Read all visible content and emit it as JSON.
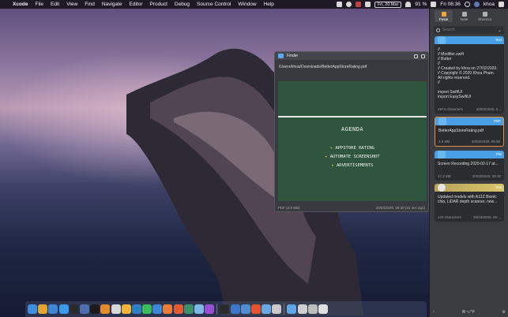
{
  "menubar": {
    "app_name": "Xcode",
    "items": [
      "File",
      "Edit",
      "View",
      "Find",
      "Navigate",
      "Editor",
      "Product",
      "Debug",
      "Source Control",
      "Window",
      "Help"
    ],
    "date": "Fri, 20 Mar",
    "battery": "91 %",
    "time": "Fri 06:36",
    "user": "khoa"
  },
  "clipboard_panel": {
    "tabs": [
      {
        "label": "Paste",
        "icon": "paste-icon"
      },
      {
        "label": "Note",
        "icon": "note-icon"
      },
      {
        "label": "Shortcut",
        "icon": "shortcut-icon"
      }
    ],
    "search_placeholder": "Search",
    "cards": [
      {
        "type": "Text",
        "accent": "#4aa0e6",
        "body": "//\n// Modifier.swift\n// Butter\n//\n// Created by khoa on 27/02/2020.\n// Copyright © 2020 Khoa Pham.\nAll rights reserved.\n//\n\nimport SwiftUI\nimport EasySwiftUI",
        "meta": "4974 characters",
        "time": "20/03/2020, 0..."
      },
      {
        "type": "PDF",
        "accent": "#4aa0e6",
        "body": "BetterAppStoreRating.pdf",
        "meta": "2,9 MB",
        "time": "20/03/2020, 06:30"
      },
      {
        "type": "File",
        "accent": "#4aa0e6",
        "body": "Screen Recording 2020-02-17 at...",
        "meta": "37,2 MB",
        "time": "20/03/2020, 06:30"
      },
      {
        "type": "Text",
        "accent": "#c9b65a",
        "body": "Updated models with A12Z Bionic chip, LiDAR depth scanner, new...",
        "meta": "133 characters",
        "time": "20/03/2020, 06:..."
      }
    ],
    "footer_shortcut": "⌘⌥^P"
  },
  "preview": {
    "title": "Finder",
    "path": "/Users/khoa/Downloads/BetterAppStoreRating.pdf",
    "slide": {
      "heading": "AGENDA",
      "items": [
        "APPSTORE RATING",
        "AUTOMATE SCREENSHOT",
        "ADVERTISEMENTS"
      ]
    },
    "file_type": "PDF (2,9 MB)",
    "timestamp": "20/03/2020, 06:30 (31 sec ago)"
  },
  "dock": {
    "apps": [
      {
        "name": "finder-icon",
        "color": "#3f8ee0"
      },
      {
        "name": "chrome-icon",
        "color": "#e5a32f"
      },
      {
        "name": "xcode-icon",
        "color": "#3b87d6"
      },
      {
        "name": "appstore-icon",
        "color": "#3a9bea"
      },
      {
        "name": "terminal-icon",
        "color": "#2b2b2b"
      },
      {
        "name": "simulator-icon",
        "color": "#4c6fb4"
      },
      {
        "name": "iterm-icon",
        "color": "#1c1c1c"
      },
      {
        "name": "sublime-icon",
        "color": "#e38c2b"
      },
      {
        "name": "photos-icon",
        "color": "#d8d8d8"
      },
      {
        "name": "sketch-icon",
        "color": "#f0b43a"
      },
      {
        "name": "vscode-icon",
        "color": "#2f7fc8"
      },
      {
        "name": "whatsapp-icon",
        "color": "#3cbb5a"
      },
      {
        "name": "safari-icon",
        "color": "#3b86d8"
      },
      {
        "name": "swift-icon",
        "color": "#ea7c3a"
      },
      {
        "name": "firefox-icon",
        "color": "#e35b34"
      },
      {
        "name": "gitkraken-icon",
        "color": "#3b8f6a"
      },
      {
        "name": "folder-icon",
        "color": "#7fb6e8"
      },
      {
        "name": "podcasts-icon",
        "color": "#9a4fd2"
      },
      {
        "name": "github-icon",
        "color": "#2b2b2b"
      },
      {
        "name": "onepassword-icon",
        "color": "#3b78c9"
      },
      {
        "name": "preview-icon",
        "color": "#4d8fd0"
      },
      {
        "name": "brave-icon",
        "color": "#e5542e"
      },
      {
        "name": "mail-icon",
        "color": "#6aa8e2"
      },
      {
        "name": "music-icon",
        "color": "#c9c9c9"
      },
      {
        "name": "downloads-folder-icon",
        "color": "#5fa6e6"
      },
      {
        "name": "window-1-icon",
        "color": "#d0d0d0"
      },
      {
        "name": "window-2-icon",
        "color": "#bcbcbc"
      },
      {
        "name": "window-3-icon",
        "color": "#e0e0e0"
      }
    ]
  }
}
